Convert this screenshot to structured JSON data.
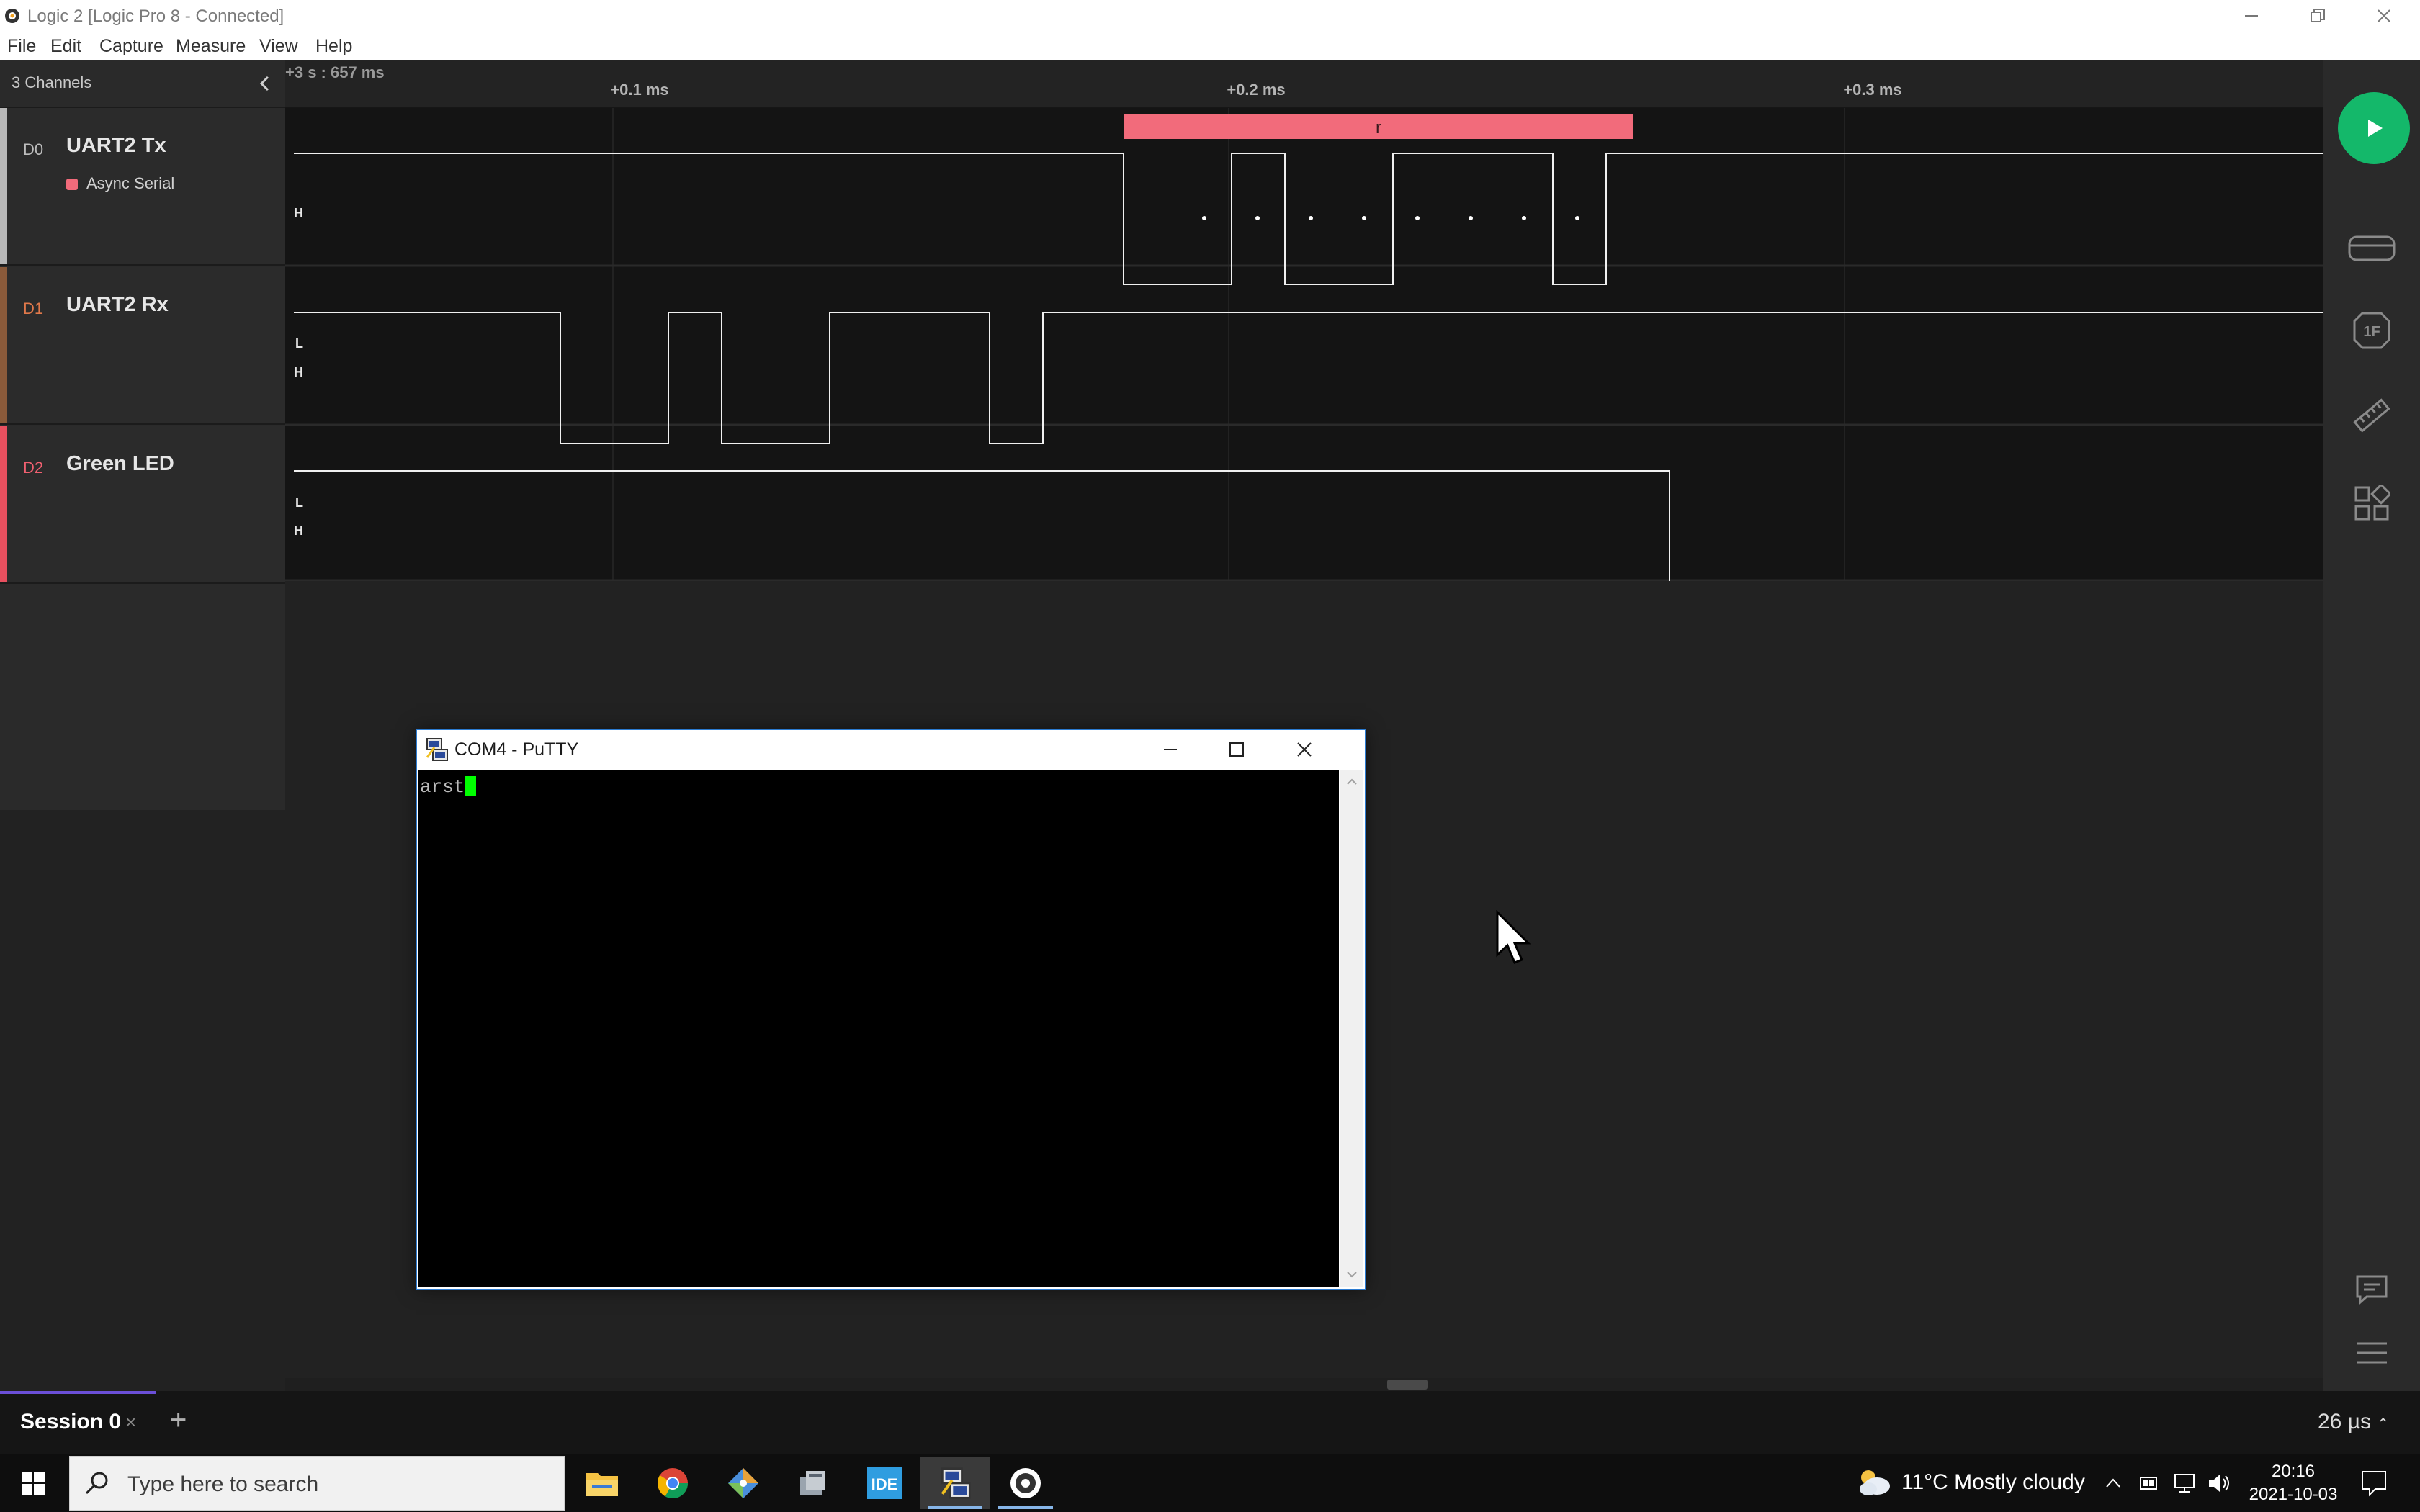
{
  "window": {
    "title": "Logic 2 [Logic Pro 8 - Connected]"
  },
  "menu": [
    "File",
    "Edit",
    "Capture",
    "Measure",
    "View",
    "Help"
  ],
  "sidebar": {
    "header": "3 Channels",
    "channels": [
      {
        "id": "D0",
        "name": "UART2 Tx",
        "color": "#b8b8b8",
        "analyzer": "Async Serial"
      },
      {
        "id": "D1",
        "name": "UART2 Rx",
        "color": "#8a5a3a",
        "analyzer": ""
      },
      {
        "id": "D2",
        "name": "Green LED",
        "color": "#e8505f",
        "analyzer": ""
      }
    ]
  },
  "timeline": {
    "origin": "+3 s : 657 ms",
    "ticks": [
      "+0.1 ms",
      "+0.2 ms",
      "+0.3 ms"
    ]
  },
  "levels": {
    "high": "H",
    "low": "L"
  },
  "decode": {
    "label": "r",
    "color": "#f26b7b"
  },
  "colors": {
    "accent_run": "#14b86a",
    "decode_bubble": "#f26b7b",
    "session_accent": "#6b4fd8",
    "terminal_cursor": "#00ff00"
  },
  "rightbar": {
    "icons": [
      "play-icon",
      "device-icon",
      "analyzers-icon",
      "measure-ruler-icon",
      "extensions-icon",
      "chat-icon",
      "menu-icon"
    ]
  },
  "session": {
    "tab": "Session 0",
    "close": "×",
    "add": "+",
    "rate": "26 µs"
  },
  "putty": {
    "title": "COM4 - PuTTY",
    "terminal_text": "arst"
  },
  "taskbar": {
    "search_placeholder": "Type here to search",
    "apps": [
      "file-explorer-icon",
      "chrome-icon",
      "git-client-icon",
      "toolbox-icon",
      "ide-icon",
      "putty-icon",
      "logic-icon"
    ],
    "ide_label": "IDE",
    "weather": "11°C  Mostly cloudy",
    "time": "20:16",
    "date": "2021-10-03"
  }
}
